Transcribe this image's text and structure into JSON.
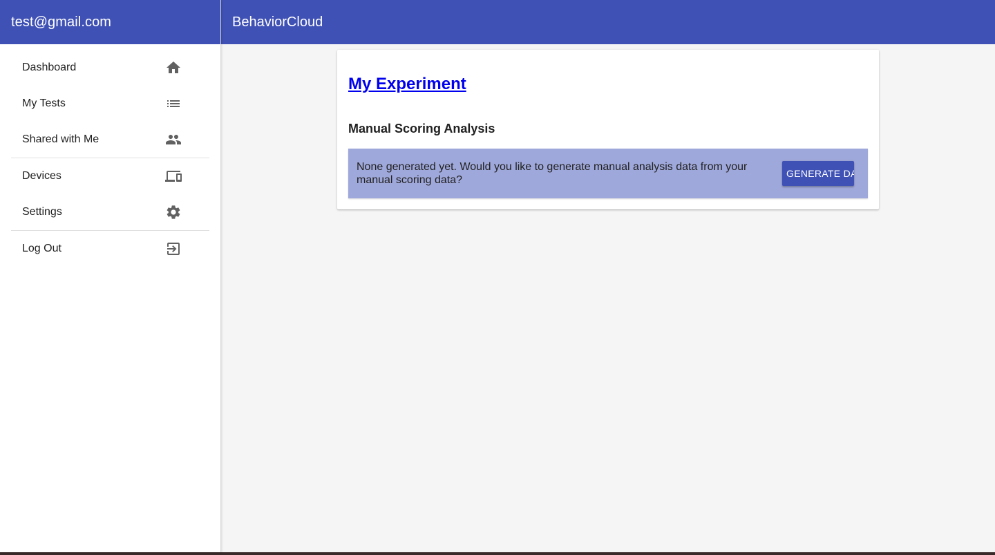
{
  "user": {
    "email": "test@gmail.com"
  },
  "app": {
    "title": "BehaviorCloud"
  },
  "sidebar": {
    "items": [
      {
        "label": "Dashboard",
        "icon": "home-icon"
      },
      {
        "label": "My Tests",
        "icon": "list-icon"
      },
      {
        "label": "Shared with Me",
        "icon": "people-icon"
      },
      {
        "label": "Devices",
        "icon": "devices-icon"
      },
      {
        "label": "Settings",
        "icon": "gear-icon"
      },
      {
        "label": "Log Out",
        "icon": "logout-icon"
      }
    ]
  },
  "main": {
    "experiment_link": "My Experiment",
    "section_title": "Manual Scoring Analysis",
    "notice_text": "None generated yet. Would you like to generate manual analysis data from your manual scoring data?",
    "generate_button_label": "GENERATE DATA"
  },
  "colors": {
    "primary": "#3f51b5",
    "notice_bg": "#9fa8da",
    "link": "#0000ee",
    "background": "#f5f5f5"
  }
}
